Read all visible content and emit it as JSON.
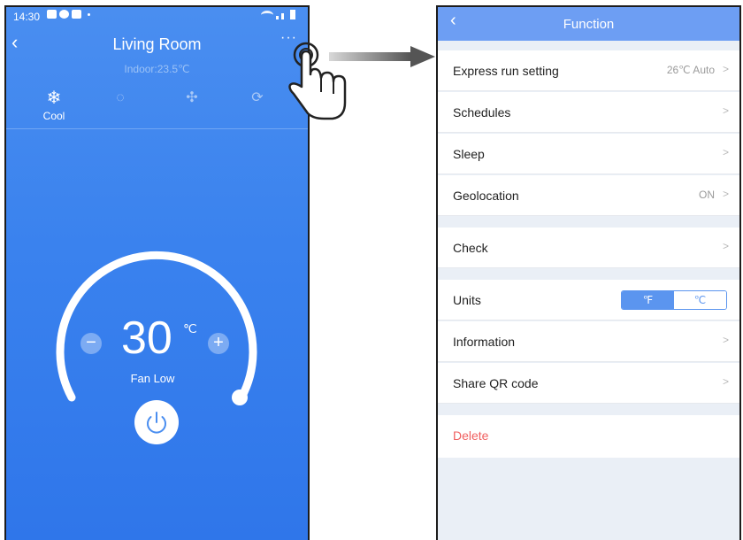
{
  "left_screen": {
    "status": {
      "time": "14:30"
    },
    "room_title": "Living Room",
    "indoor_temp": "Indoor:23.5℃",
    "more_icon": "more-dots-icon",
    "modes": [
      {
        "icon": "snowflake-icon",
        "glyph": "❄",
        "label": "Cool",
        "active": true
      },
      {
        "icon": "droplet-icon",
        "glyph": "◌",
        "label": "",
        "active": false
      },
      {
        "icon": "fan-icon",
        "glyph": "✣",
        "label": "",
        "active": false
      },
      {
        "icon": "auto-cycle-icon",
        "glyph": "⟳",
        "label": "",
        "active": false
      }
    ],
    "temperature": {
      "value": "30",
      "unit": "℃",
      "setpoint_fraction": 1.0
    },
    "fan": "Fan Low",
    "minus_label": "−",
    "plus_label": "+"
  },
  "right_screen": {
    "title": "Function",
    "rows": [
      {
        "label": "Express run setting",
        "value": "26℃ Auto",
        "chevron": true
      },
      {
        "label": "Schedules",
        "value": "",
        "chevron": true
      },
      {
        "label": "Sleep",
        "value": "",
        "chevron": true
      },
      {
        "label": "Geolocation",
        "value": "ON",
        "chevron": true
      },
      {
        "label": "Check",
        "value": "",
        "chevron": true
      },
      {
        "label": "Units",
        "toggle": [
          "℉",
          "℃"
        ],
        "selected": "℉"
      },
      {
        "label": "Information",
        "value": "",
        "chevron": true
      },
      {
        "label": "Share QR code",
        "value": "",
        "chevron": true
      },
      {
        "label": "Delete",
        "value": "",
        "chevron": false
      }
    ]
  },
  "colors": {
    "header_blue": "#6d9ef3",
    "app_blue": "#3a82ee",
    "delete_red": "#f06060",
    "background_gray": "#eaeff6"
  }
}
